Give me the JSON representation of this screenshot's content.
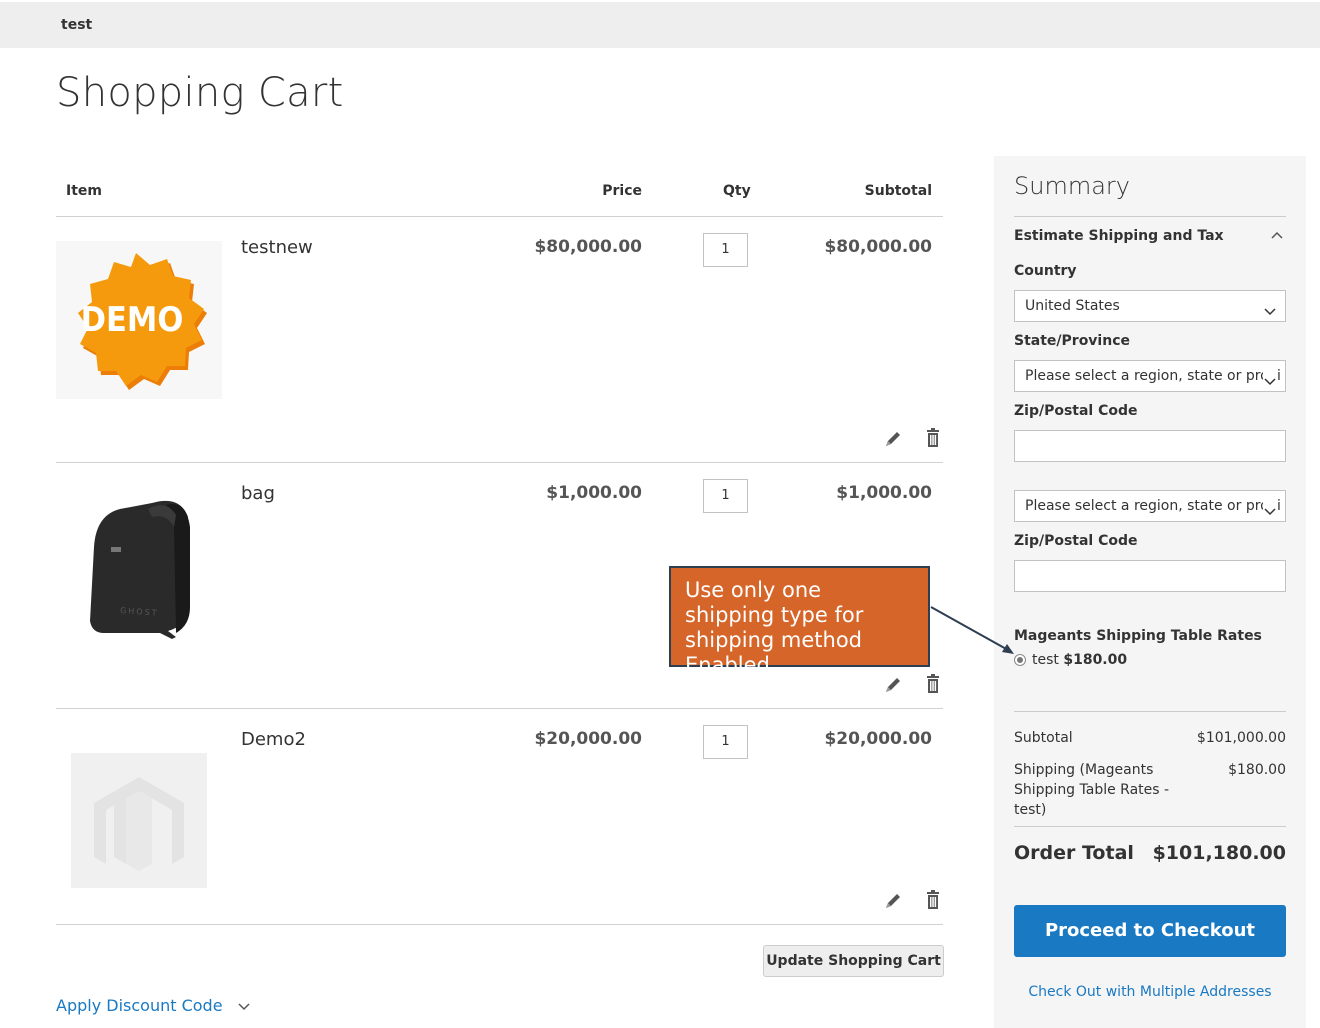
{
  "header": {
    "store_name": "test"
  },
  "page": {
    "title": "Shopping Cart"
  },
  "cart": {
    "columns": {
      "item": "Item",
      "price": "Price",
      "qty": "Qty",
      "subtotal": "Subtotal"
    },
    "items": [
      {
        "name": "testnew",
        "price": "$80,000.00",
        "qty": "1",
        "subtotal": "$80,000.00",
        "image_text": "DEMO"
      },
      {
        "name": "bag",
        "price": "$1,000.00",
        "qty": "1",
        "subtotal": "$1,000.00",
        "image_text": "GHOST"
      },
      {
        "name": "Demo2",
        "price": "$20,000.00",
        "qty": "1",
        "subtotal": "$20,000.00"
      }
    ],
    "update_label": "Update Shopping Cart",
    "discount_label": "Apply Discount Code"
  },
  "summary": {
    "title": "Summary",
    "estimate_label": "Estimate Shipping and Tax",
    "country_label": "Country",
    "country_value": "United States",
    "state_label": "State/Province",
    "state_placeholder": "Please select a region, state or provi",
    "zip_label": "Zip/Postal Code",
    "zip_value": "",
    "state_placeholder_2": "Please select a region, state or provi",
    "zip_label_2": "Zip/Postal Code",
    "zip_value_2": "",
    "method_title": "Mageants Shipping Table Rates",
    "rate_name": "test",
    "rate_price": "$180.00",
    "subtotal_label": "Subtotal",
    "subtotal_value": "$101,000.00",
    "shipping_label": "Shipping (Mageants Shipping Table Rates - test)",
    "shipping_value": "$180.00",
    "order_total_label": "Order Total",
    "order_total_value": "$101,180.00",
    "checkout_label": "Proceed to Checkout",
    "multi_label": "Check Out with Multiple Addresses"
  },
  "annotation": {
    "text": "Use only one shipping type for shipping method Enabled"
  },
  "colors": {
    "accent": "#1979c3",
    "callout": "#d6652a",
    "callout_border": "#2c3e50",
    "demo_badge": "#f59a0c"
  }
}
